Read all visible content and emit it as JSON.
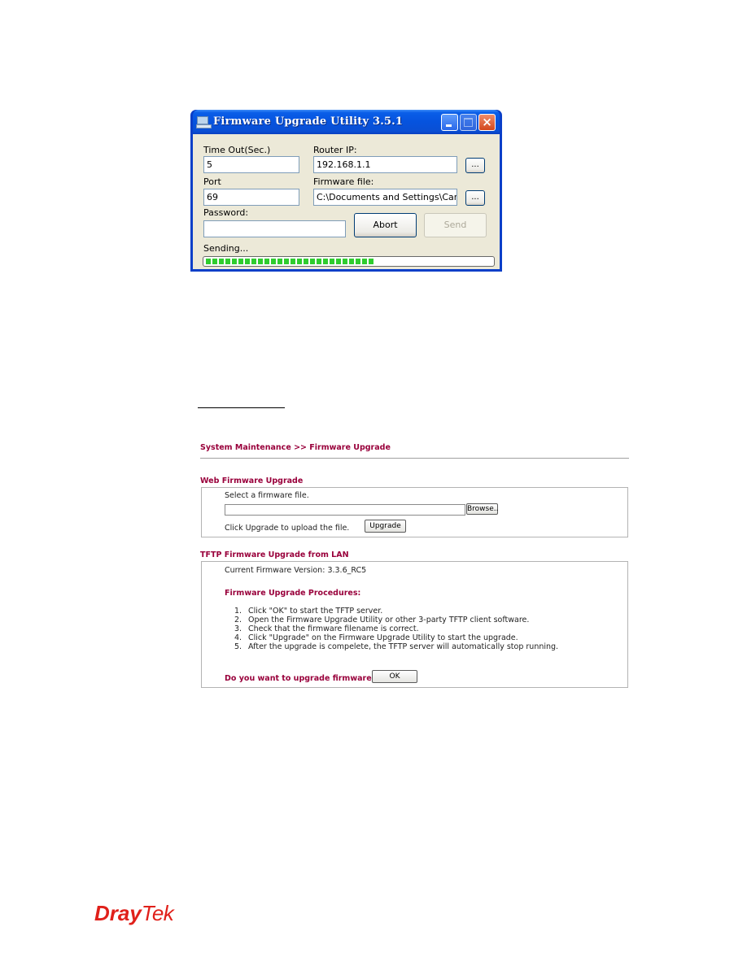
{
  "utility_window": {
    "title": "Firmware Upgrade Utility 3.5.1",
    "controls": {
      "minimize": "minimize",
      "maximize": "maximize",
      "close": "×"
    },
    "fields": {
      "timeout": {
        "label": "Time Out(Sec.)",
        "value": "5"
      },
      "router_ip": {
        "label": "Router IP:",
        "value": "192.168.1.1"
      },
      "port": {
        "label": "Port",
        "value": "69"
      },
      "firmware_file": {
        "label": "Firmware file:",
        "value": "C:\\Documents and Settings\\Carrie"
      },
      "password": {
        "label": "Password:",
        "value": ""
      }
    },
    "browse_button_label": "...",
    "abort_button_label": "Abort",
    "send_button_label": "Send",
    "status_text": "Sending...",
    "progress_blocks_filled": 26,
    "progress_percent": 52,
    "progress_color": "#2fcc2f"
  },
  "web_page": {
    "breadcrumb": "System Maintenance >> Firmware Upgrade",
    "web_upgrade": {
      "title": "Web Firmware Upgrade",
      "select_text": "Select a firmware file.",
      "file_value": "",
      "browse_label": "Browse..",
      "click_text": "Click Upgrade to upload the file.",
      "upgrade_label": "Upgrade"
    },
    "tftp_upgrade": {
      "title": "TFTP Firmware Upgrade from LAN",
      "current_version_label": "Current Firmware Version:",
      "current_version": "3.3.6_RC5",
      "procedures_title": "Firmware Upgrade Procedures:",
      "steps": [
        {
          "num": "1.",
          "text": "Click \"OK\" to start the TFTP server."
        },
        {
          "num": "2.",
          "text": "Open the Firmware Upgrade Utility or other 3-party TFTP client software."
        },
        {
          "num": "3.",
          "text": "Check that the firmware filename is correct."
        },
        {
          "num": "4.",
          "text": "Click \"Upgrade\" on the Firmware Upgrade Utility to start the upgrade."
        },
        {
          "num": "5.",
          "text": "After the upgrade is compelete, the TFTP server will automatically stop running."
        }
      ],
      "question": "Do you want to upgrade firmware ?",
      "ok_label": "OK"
    },
    "accent_color": "#99003b"
  },
  "footer_logo": {
    "part1": "Dray",
    "part2": "Tek",
    "color": "#e0201a"
  }
}
